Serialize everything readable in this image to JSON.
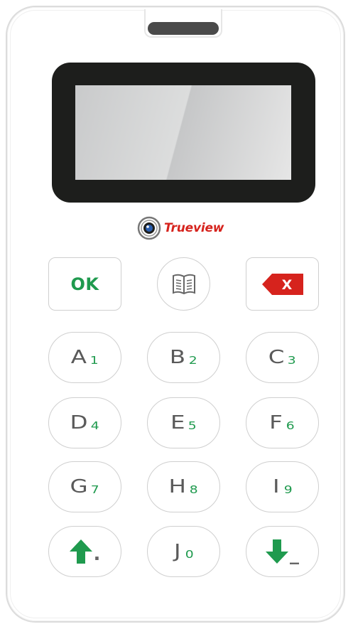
{
  "logo": {
    "text": "Trueview",
    "color": "#d6231d"
  },
  "keys": {
    "ok": {
      "label": "OK",
      "icon": "ok-text"
    },
    "menu": {
      "icon": "book-icon"
    },
    "delete": {
      "label": "X",
      "icon": "backspace-icon",
      "color": "#d6231d"
    },
    "a": {
      "letter": "A",
      "digit": "1"
    },
    "b": {
      "letter": "B",
      "digit": "2"
    },
    "c": {
      "letter": "C",
      "digit": "3"
    },
    "d": {
      "letter": "D",
      "digit": "4"
    },
    "e": {
      "letter": "E",
      "digit": "5"
    },
    "f": {
      "letter": "F",
      "digit": "6"
    },
    "g": {
      "letter": "G",
      "digit": "7"
    },
    "h": {
      "letter": "H",
      "digit": "8"
    },
    "i": {
      "letter": "I",
      "digit": "9"
    },
    "up": {
      "icon": "up-arrow-icon",
      "symbol": "."
    },
    "j": {
      "letter": "J",
      "digit": "0"
    },
    "down": {
      "icon": "down-arrow-icon",
      "symbol": "_"
    }
  },
  "colors": {
    "accent_green": "#1f9a4e",
    "accent_red": "#d6231d",
    "bezel": "#1d1e1c",
    "key_text": "#5a5a5a"
  }
}
